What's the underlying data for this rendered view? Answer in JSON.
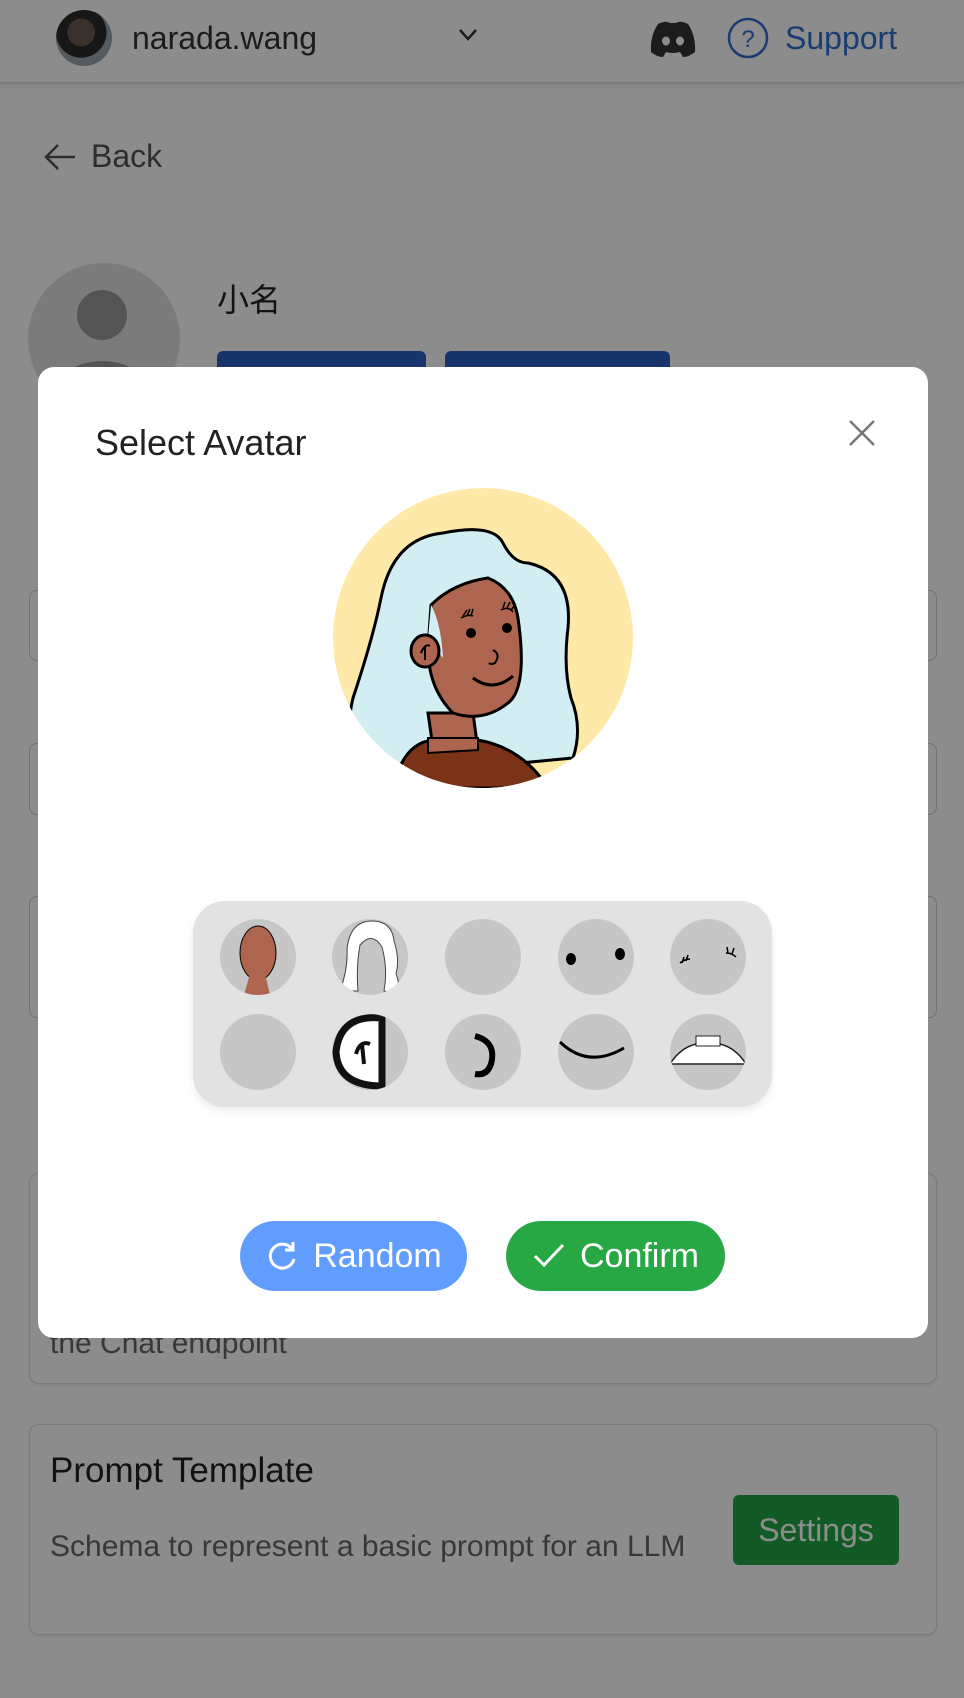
{
  "header": {
    "username": "narada.wang",
    "dropdown_icon": "chevron-down-icon",
    "discord_icon": "discord-icon",
    "support_icon": "question-circle-icon",
    "support_label": "Support"
  },
  "page": {
    "back_label": "Back",
    "profile_name": "小名",
    "cards": [
      {
        "desc_tail": "the Chat endpoint"
      },
      {
        "title": "Prompt Template",
        "desc": "Schema to represent a basic prompt for an LLM",
        "button": "Settings"
      }
    ]
  },
  "modal": {
    "title": "Select Avatar",
    "close_icon": "close-icon",
    "parts": [
      "face",
      "hair",
      "blank",
      "eyes",
      "eyebrows",
      "accessory",
      "ear",
      "nose",
      "mouth",
      "body"
    ],
    "random_label": "Random",
    "confirm_label": "Confirm",
    "colors": {
      "random": "#619cff",
      "confirm": "#28a745",
      "avatar_bg": "#ffe9a8",
      "hair": "#d3eef3",
      "skin": "#ad654f",
      "shirt": "#7a3318"
    }
  }
}
